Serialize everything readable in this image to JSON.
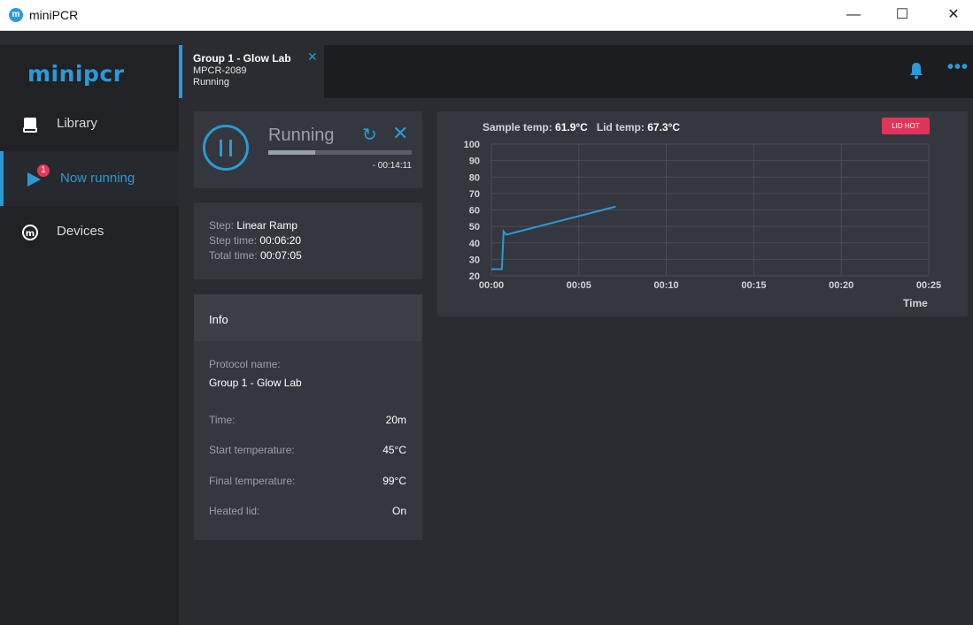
{
  "window": {
    "title": "miniPCR"
  },
  "sidebar": {
    "logo": "minipcr",
    "items": [
      {
        "label": "Library"
      },
      {
        "label": "Now running",
        "badge": "1"
      },
      {
        "label": "Devices"
      }
    ]
  },
  "tab": {
    "title": "Group 1 - Glow Lab",
    "device": "MPCR-2089",
    "status": "Running"
  },
  "run": {
    "status": "Running",
    "remaining": "- 00:14:11",
    "progress_fraction": 0.33
  },
  "step": {
    "step_label": "Step: ",
    "step_value": "Linear Ramp",
    "step_time_label": "Step time: ",
    "step_time_value": "00:06:20",
    "total_time_label": "Total time: ",
    "total_time_value": "00:07:05"
  },
  "info": {
    "title": "Info",
    "protocol_name_label": "Protocol name:",
    "protocol_name": "Group 1 - Glow Lab",
    "rows": [
      {
        "label": "Time:",
        "value": "20m"
      },
      {
        "label": "Start temperature:",
        "value": "45°C"
      },
      {
        "label": "Final temperature:",
        "value": "99°C"
      },
      {
        "label": "Heated lid:",
        "value": "On"
      }
    ]
  },
  "chart_header": {
    "sample_label": "Sample temp:",
    "sample_value": "61.9°C",
    "lid_label": "Lid temp:",
    "lid_value": "67.3°C",
    "lid_hot": "LID HOT"
  },
  "chart_data": {
    "type": "line",
    "title": "",
    "xlabel": "Time",
    "ylabel": "",
    "x_ticks": [
      "00:00",
      "00:05",
      "00:10",
      "00:15",
      "00:20",
      "00:25"
    ],
    "y_ticks": [
      20,
      30,
      40,
      50,
      60,
      70,
      80,
      90,
      100
    ],
    "xlim": [
      0,
      25
    ],
    "ylim": [
      20,
      100
    ],
    "grid": true,
    "color": "#2b9ad8",
    "series": [
      {
        "x": [
          0,
          0.6,
          0.7,
          0.85,
          7.1
        ],
        "y": [
          24,
          24,
          47,
          45,
          62
        ]
      }
    ]
  }
}
